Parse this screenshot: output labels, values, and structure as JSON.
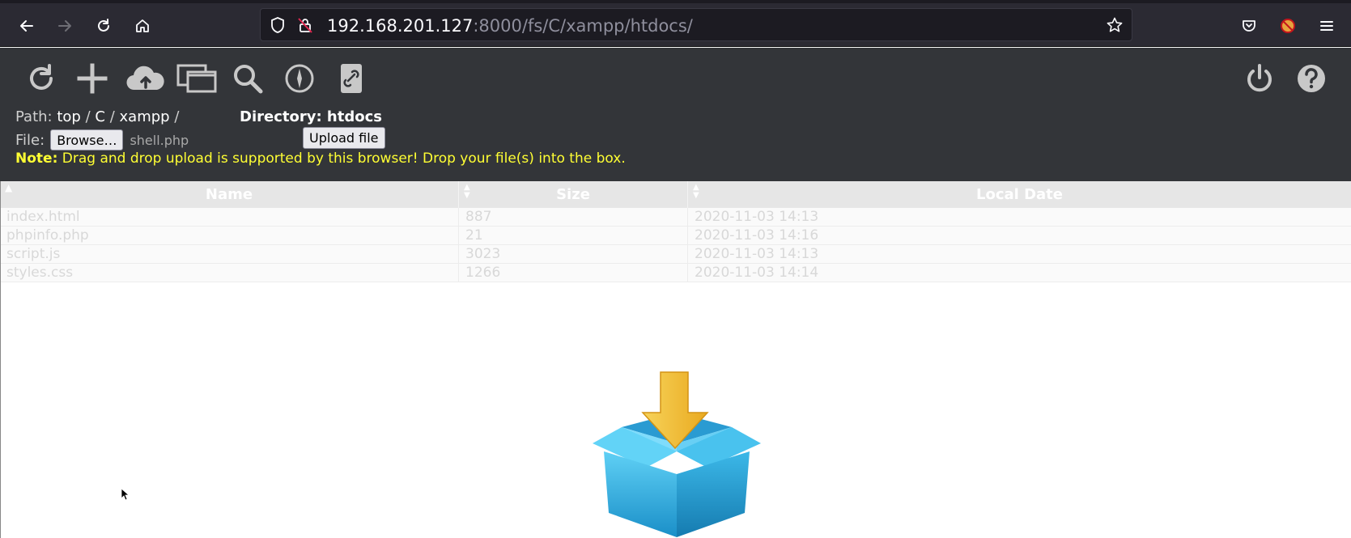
{
  "browser": {
    "url_host": "192.168.201.127",
    "url_rest": ":8000/fs/C/xampp/htdocs/"
  },
  "toolbar": {
    "icons": [
      "refresh-icon",
      "plus-icon",
      "cloud-upload-icon",
      "windows-icon",
      "search-icon",
      "compass-icon",
      "link-icon",
      "power-icon",
      "help-icon"
    ]
  },
  "path": {
    "label": "Path:",
    "crumbs": [
      "top",
      "/",
      "C",
      "/",
      "xampp",
      "/"
    ]
  },
  "directory": {
    "label": "Directory: htdocs"
  },
  "file": {
    "label": "File:",
    "browse_label": "Browse…",
    "selected_name": "shell.php",
    "upload_label": "Upload file"
  },
  "note": {
    "strong": "Note:",
    "text": " Drag and drop upload is supported by this browser! Drop your file(s) into the box."
  },
  "table": {
    "headers": [
      "Name",
      "Size",
      "Local Date"
    ],
    "rows": [
      [
        "index.html",
        "887",
        "2020-11-03 14:13"
      ],
      [
        "phpinfo.php",
        "21",
        "2020-11-03 14:16"
      ],
      [
        "script.js",
        "3023",
        "2020-11-03 14:13"
      ],
      [
        "styles.css",
        "1266",
        "2020-11-03 14:14"
      ]
    ]
  },
  "colors": {
    "header_bg": "#333539",
    "note": "#ffff33",
    "browser_bg": "#2b2a33"
  }
}
